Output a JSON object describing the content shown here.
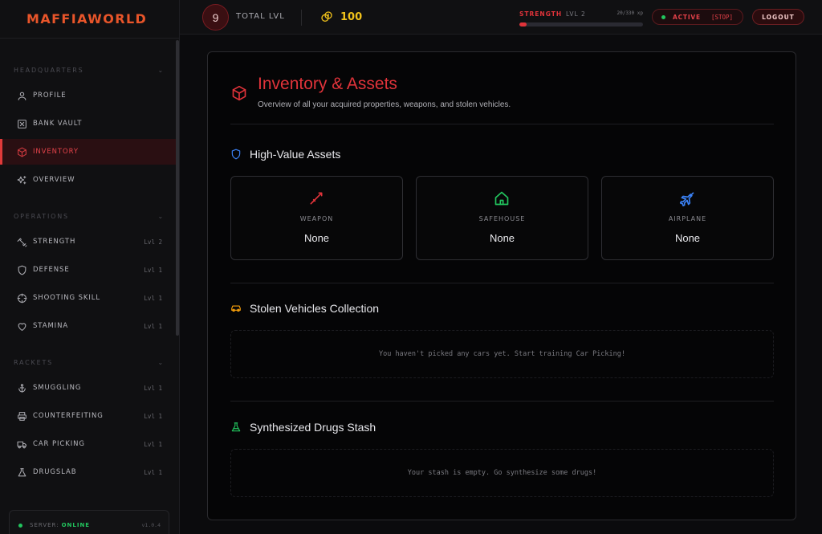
{
  "app": {
    "brand": "MAFFIAWORLD"
  },
  "sidebar": {
    "sections": [
      {
        "title": "HEADQUARTERS",
        "items": [
          {
            "label": "PROFILE",
            "icon": "user-icon"
          },
          {
            "label": "BANK VAULT",
            "icon": "vault-icon"
          },
          {
            "label": "INVENTORY",
            "icon": "box-icon",
            "active": true
          },
          {
            "label": "OVERVIEW",
            "icon": "sparkles-icon"
          }
        ]
      },
      {
        "title": "OPERATIONS",
        "items": [
          {
            "label": "STRENGTH",
            "level": "Lvl 2",
            "icon": "dumbbell-icon"
          },
          {
            "label": "DEFENSE",
            "level": "Lvl 1",
            "icon": "shield-icon"
          },
          {
            "label": "SHOOTING SKILL",
            "level": "Lvl 1",
            "icon": "crosshair-icon"
          },
          {
            "label": "STAMINA",
            "level": "Lvl 1",
            "icon": "heart-icon"
          }
        ]
      },
      {
        "title": "RACKETS",
        "items": [
          {
            "label": "SMUGGLING",
            "level": "Lvl 1",
            "icon": "anchor-icon"
          },
          {
            "label": "COUNTERFEITING",
            "level": "Lvl 1",
            "icon": "printer-icon"
          },
          {
            "label": "CAR PICKING",
            "level": "Lvl 1",
            "icon": "truck-icon"
          },
          {
            "label": "DRUGSLAB",
            "level": "Lvl 1",
            "icon": "flask-icon"
          }
        ]
      }
    ],
    "server": {
      "label": "SERVER:",
      "status": "ONLINE",
      "version": "v1.0.4",
      "status_color": "#22c55e"
    }
  },
  "topbar": {
    "total_level": "9",
    "total_level_label": "TOTAL LVL",
    "coins": "100",
    "skill": {
      "name": "STRENGTH",
      "level": "LVL 2",
      "xp": "20/330 xp",
      "progress": 0.06
    },
    "status": {
      "label": "ACTIVE",
      "stop": "[STOP]"
    },
    "logout": "LOGOUT"
  },
  "main": {
    "title": "Inventory & Assets",
    "subtitle": "Overview of all your acquired properties, weapons, and stolen vehicles.",
    "high_value": {
      "title": "High-Value Assets",
      "cards": [
        {
          "label": "WEAPON",
          "value": "None",
          "icon": "sword-icon",
          "color": "#e0333a"
        },
        {
          "label": "SAFEHOUSE",
          "value": "None",
          "icon": "home-icon",
          "color": "#22c55e"
        },
        {
          "label": "AIRPLANE",
          "value": "None",
          "icon": "plane-icon",
          "color": "#3b82f6"
        }
      ]
    },
    "vehicles": {
      "title": "Stolen Vehicles Collection",
      "empty": "You haven't picked any cars yet. Start training Car Picking!"
    },
    "drugs": {
      "title": "Synthesized Drugs Stash",
      "empty": "Your stash is empty. Go synthesize some drugs!"
    }
  },
  "colors": {
    "accent": "#e0333a",
    "brand": "#e8552a",
    "gold": "#f1c21b",
    "online": "#22c55e"
  }
}
